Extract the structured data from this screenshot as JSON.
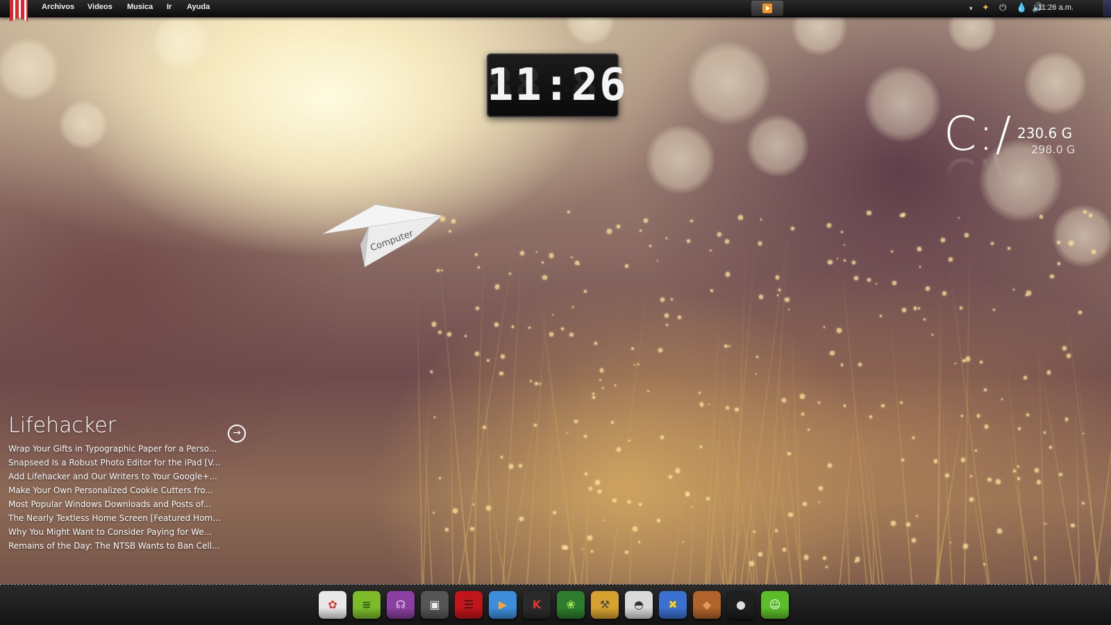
{
  "menubar": {
    "items": [
      "Archivos",
      "Videos",
      "Musica",
      "Ir",
      "Ayuda"
    ],
    "clock": "11:26 a.m.",
    "tray_icons": [
      "chevron-down-icon",
      "network-icon",
      "power-icon",
      "drop-icon",
      "volume-icon"
    ],
    "media_icon": "play-icon"
  },
  "clock_widget": {
    "time": "11:26"
  },
  "desktop": {
    "plane_label": "Computer"
  },
  "drive_widget": {
    "letter": "C:/",
    "free": "230.6 G",
    "total": "298.0 G"
  },
  "rss": {
    "title": "Lifehacker",
    "items": [
      "Wrap Your Gifts in Typographic Paper for a Perso...",
      "Snapseed Is a Robust Photo Editor for the iPad [V...",
      "Add Lifehacker and Our Writers to Your Google+...",
      "Make Your Own Personalized Cookie Cutters fro...",
      "Most Popular Windows Downloads and Posts of...",
      "The Nearly Textless Home Screen [Featured Hom...",
      "Why You Might Want to Consider Paying for We...",
      "Remains of the Day: The NTSB Wants to Ban Cell..."
    ]
  },
  "dock": {
    "icons": [
      {
        "name": "picasa-icon",
        "bg": "#e8e8e8",
        "fg": "#d23a2a"
      },
      {
        "name": "spotify-icon",
        "bg": "#7dbb2a",
        "fg": "#2a5a10"
      },
      {
        "name": "headphones-icon",
        "bg": "#8b3fa0",
        "fg": "#e8c8f0"
      },
      {
        "name": "film-icon",
        "bg": "#555555",
        "fg": "#eeeeee"
      },
      {
        "name": "filmstrip-icon",
        "bg": "#c0151a",
        "fg": "#1a1a1a"
      },
      {
        "name": "vlc-icon",
        "bg": "#3c8edb",
        "fg": "#f7a43a"
      },
      {
        "name": "k-app-icon",
        "bg": "#2a2a2a",
        "fg": "#e03a2a"
      },
      {
        "name": "clover-icon",
        "bg": "#2e7d2e",
        "fg": "#a6e65a"
      },
      {
        "name": "tools-icon",
        "bg": "#d7a12f",
        "fg": "#444444"
      },
      {
        "name": "drive-icon",
        "bg": "#dadada",
        "fg": "#333333"
      },
      {
        "name": "windows-icon",
        "bg": "#3b6fd0",
        "fg": "#f7d21b"
      },
      {
        "name": "leather-icon",
        "bg": "#b0632b",
        "fg": "#e09b5b"
      },
      {
        "name": "lamp-icon",
        "bg": "#1e1e1e",
        "fg": "#dddddd"
      },
      {
        "name": "android-icon",
        "bg": "#5bbd2a",
        "fg": "#ffffff"
      }
    ]
  }
}
